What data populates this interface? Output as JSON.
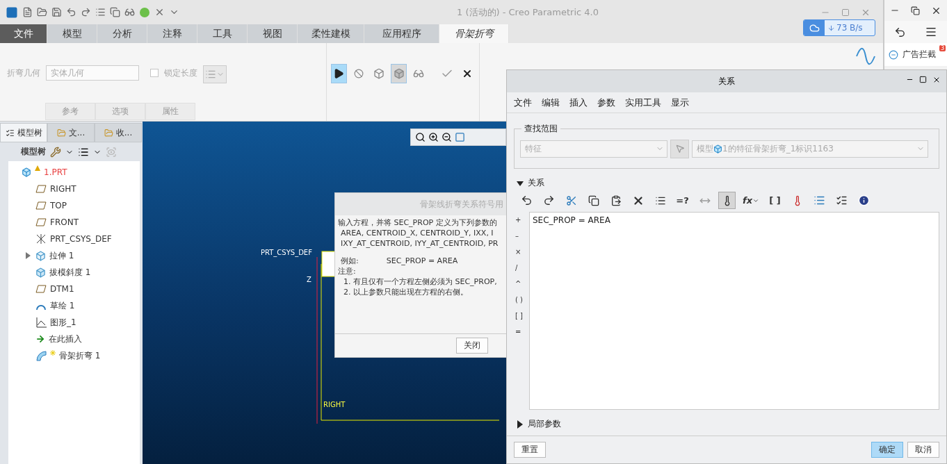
{
  "title_bar": {
    "title": "1 (活动的) - Creo Parametric 4.0"
  },
  "ribbon_tabs": [
    {
      "label": "文件",
      "kind": "file",
      "selected": false
    },
    {
      "label": "模型",
      "kind": "tab",
      "selected": false
    },
    {
      "label": "分析",
      "kind": "tab",
      "selected": false
    },
    {
      "label": "注释",
      "kind": "tab",
      "selected": false
    },
    {
      "label": "工具",
      "kind": "tab",
      "selected": false
    },
    {
      "label": "视图",
      "kind": "tab",
      "selected": false
    },
    {
      "label": "柔性建模",
      "kind": "tab",
      "selected": false
    },
    {
      "label": "应用程序",
      "kind": "tab",
      "selected": false
    },
    {
      "label": "骨架折弯",
      "kind": "tab",
      "selected": true
    }
  ],
  "ribbon": {
    "geometry_label": "折弯几何",
    "geometry_value": "实体几何",
    "disabled": true,
    "lock_length": {
      "label": "锁定长度",
      "checked": false
    },
    "group_tabs": [
      "参考",
      "选项",
      "属性"
    ],
    "tools": [
      {
        "kind": "play",
        "selected": true
      },
      {
        "kind": "stop",
        "selected": false
      },
      {
        "kind": "wireframe",
        "selected": false
      },
      {
        "kind": "solid",
        "selected": true
      },
      {
        "kind": "glasses",
        "selected": false
      },
      {
        "kind": "ok",
        "selected": false
      },
      {
        "kind": "cancel",
        "selected": false
      }
    ]
  },
  "browser": {
    "speed": "73 B/s",
    "adblock": "广告拦截",
    "adblock_count": "3"
  },
  "model_tree": {
    "tabs": [
      {
        "label": "模型树",
        "kind": "tree",
        "selected": true
      },
      {
        "label": "文...",
        "kind": "folder",
        "selected": false
      },
      {
        "label": "收...",
        "kind": "favorite",
        "selected": false
      }
    ],
    "toolbar_label": "模型树",
    "items": [
      {
        "label": "1.PRT",
        "kind": "part",
        "children": [
          {
            "label": "RIGHT",
            "kind": "plane"
          },
          {
            "label": "TOP",
            "kind": "plane"
          },
          {
            "label": "FRONT",
            "kind": "plane"
          },
          {
            "label": "PRT_CSYS_DEF",
            "kind": "csys"
          },
          {
            "label": "拉伸 1",
            "kind": "extrude",
            "expanded": false
          },
          {
            "label": "拔模斜度 1",
            "kind": "draft"
          },
          {
            "label": "DTM1",
            "kind": "plane"
          },
          {
            "label": "草绘 1",
            "kind": "sketch"
          },
          {
            "label": "图形_1",
            "kind": "graph"
          },
          {
            "label": "在此插入",
            "kind": "insert"
          },
          {
            "label": "骨架折弯 1",
            "kind": "new"
          }
        ]
      }
    ]
  },
  "viewport": {
    "csys_label": "PRT_CSYS_DEF",
    "axis_label": "Z",
    "plane_label": "RIGHT"
  },
  "help_dialog": {
    "title": "骨架线折弯关系符号用",
    "lines": [
      "输入方程，并将 SEC_PROP 定义为下列参数的",
      "AREA, CENTROID_X, CENTROID_Y, IXX, I",
      "IXY_AT_CENTROID, IYY_AT_CENTROID, PR"
    ],
    "example_label": "例如:",
    "example_value": "SEC_PROP = AREA",
    "note_label": "注意:",
    "notes": [
      "1. 有且仅有一个方程左侧必须为 SEC_PROP,",
      "2. 以上参数只能出现在方程的右侧。"
    ],
    "close": "关闭"
  },
  "relations_dialog": {
    "title": "关系",
    "menus": [
      "文件",
      "编辑",
      "插入",
      "参数",
      "实用工具",
      "显示"
    ],
    "scope_label": "查找范围",
    "scope_type": "特征",
    "scope_prefix": "模型",
    "scope_value": "1的特征骨架折弯_1标识1163",
    "scope_disabled": true,
    "relations_section": {
      "label": "关系",
      "expanded": true
    },
    "text_tools": [
      "=?",
      "fx",
      "[ ]"
    ],
    "units_on": true,
    "operators": [
      "+",
      "–",
      "×",
      "/",
      "^",
      "( )",
      "[ ]",
      "="
    ],
    "relation_text": "SEC_PROP = AREA",
    "local_section": {
      "label": "局部参数",
      "expanded": false
    },
    "buttons": [
      {
        "label": "重置",
        "kind": "reset"
      },
      {
        "label": "确定",
        "kind": "primary"
      },
      {
        "label": "取消",
        "kind": "cancel"
      }
    ]
  }
}
